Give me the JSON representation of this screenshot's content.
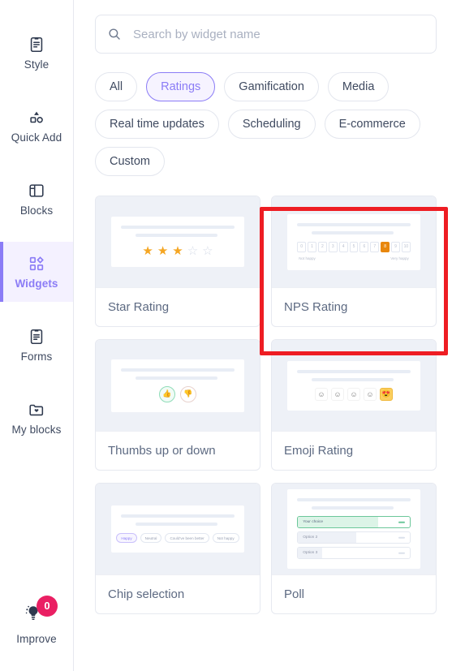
{
  "sidebar": {
    "items": [
      {
        "label": "Style",
        "icon": "style-icon",
        "active": false
      },
      {
        "label": "Quick Add",
        "icon": "quick-add-icon",
        "active": false
      },
      {
        "label": "Blocks",
        "icon": "blocks-icon",
        "active": false
      },
      {
        "label": "Widgets",
        "icon": "widgets-icon",
        "active": true
      },
      {
        "label": "Forms",
        "icon": "forms-icon",
        "active": false
      },
      {
        "label": "My blocks",
        "icon": "my-blocks-icon",
        "active": false
      }
    ],
    "improve": {
      "label": "Improve",
      "icon": "lightbulb-icon",
      "badge": "0"
    }
  },
  "search": {
    "placeholder": "Search by widget name",
    "value": "",
    "icon": "search-icon"
  },
  "filters": {
    "chips": [
      {
        "label": "All",
        "active": false
      },
      {
        "label": "Ratings",
        "active": true
      },
      {
        "label": "Gamification",
        "active": false
      },
      {
        "label": "Media",
        "active": false
      },
      {
        "label": "Real time updates",
        "active": false
      },
      {
        "label": "Scheduling",
        "active": false
      },
      {
        "label": "E-commerce",
        "active": false
      },
      {
        "label": "Custom",
        "active": false
      }
    ]
  },
  "widgets": {
    "cards": [
      {
        "title": "Star Rating",
        "preview": "stars",
        "highlighted": false
      },
      {
        "title": "NPS Rating",
        "preview": "nps",
        "highlighted": true
      },
      {
        "title": "Thumbs up or down",
        "preview": "thumbs",
        "highlighted": false
      },
      {
        "title": "Emoji Rating",
        "preview": "emoji",
        "highlighted": false
      },
      {
        "title": "Chip selection",
        "preview": "chips",
        "highlighted": false
      },
      {
        "title": "Poll",
        "preview": "poll",
        "highlighted": false
      }
    ]
  },
  "previews": {
    "stars": {
      "filled": 3,
      "total": 5
    },
    "nps": {
      "scale": [
        "0",
        "1",
        "2",
        "3",
        "4",
        "5",
        "6",
        "7",
        "8",
        "9",
        "10"
      ],
      "selected": "8",
      "left_label": "Not happy",
      "right_label": "Very happy"
    },
    "thumbs": {
      "up": "👍",
      "down": "👎",
      "selected": "up"
    },
    "emoji": {
      "faces": [
        "☺",
        "☺",
        "☺",
        "☺",
        "😍"
      ],
      "selected_index": 4
    },
    "chips": {
      "options": [
        "Happy",
        "Neutral",
        "Could've been better",
        "Not happy"
      ],
      "selected_index": 0
    },
    "poll": {
      "options": [
        "Your choice",
        "Option 2",
        "Option 3"
      ],
      "selected_index": 0
    }
  },
  "colors": {
    "accent": "#8b7cf6",
    "star": "#f5a623",
    "nps_selected": "#e8870d",
    "poll_selected": "#6cc79a",
    "badge": "#ea1f63",
    "annotation": "#ee1d23"
  }
}
